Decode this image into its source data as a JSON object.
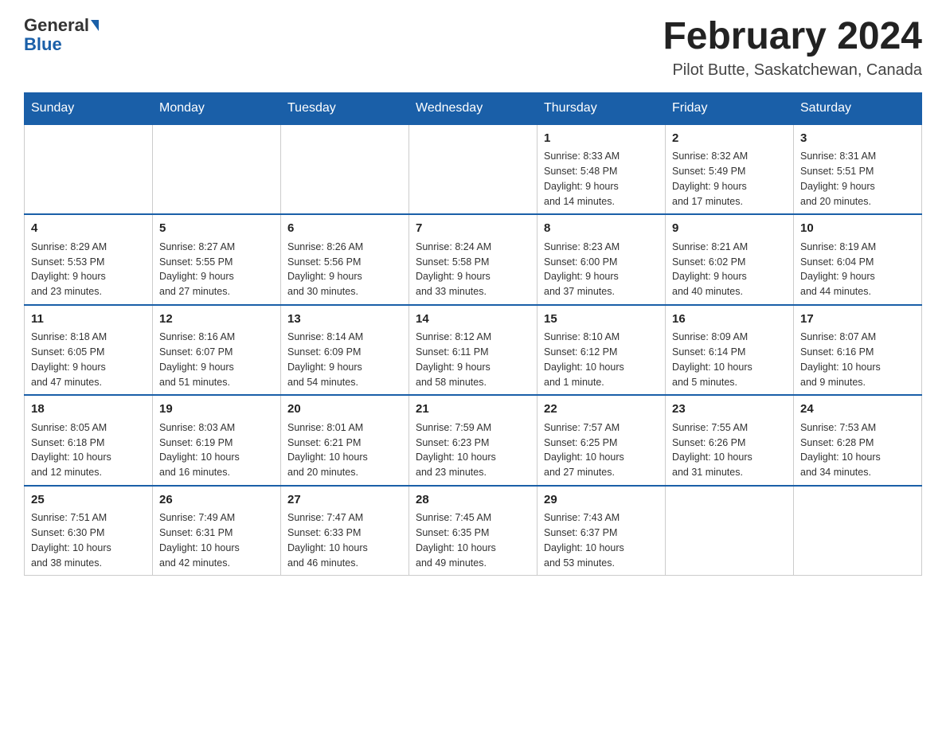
{
  "header": {
    "logo_general": "General",
    "logo_blue": "Blue",
    "month_title": "February 2024",
    "location": "Pilot Butte, Saskatchewan, Canada"
  },
  "weekdays": [
    "Sunday",
    "Monday",
    "Tuesday",
    "Wednesday",
    "Thursday",
    "Friday",
    "Saturday"
  ],
  "weeks": [
    [
      {
        "day": "",
        "info": ""
      },
      {
        "day": "",
        "info": ""
      },
      {
        "day": "",
        "info": ""
      },
      {
        "day": "",
        "info": ""
      },
      {
        "day": "1",
        "info": "Sunrise: 8:33 AM\nSunset: 5:48 PM\nDaylight: 9 hours\nand 14 minutes."
      },
      {
        "day": "2",
        "info": "Sunrise: 8:32 AM\nSunset: 5:49 PM\nDaylight: 9 hours\nand 17 minutes."
      },
      {
        "day": "3",
        "info": "Sunrise: 8:31 AM\nSunset: 5:51 PM\nDaylight: 9 hours\nand 20 minutes."
      }
    ],
    [
      {
        "day": "4",
        "info": "Sunrise: 8:29 AM\nSunset: 5:53 PM\nDaylight: 9 hours\nand 23 minutes."
      },
      {
        "day": "5",
        "info": "Sunrise: 8:27 AM\nSunset: 5:55 PM\nDaylight: 9 hours\nand 27 minutes."
      },
      {
        "day": "6",
        "info": "Sunrise: 8:26 AM\nSunset: 5:56 PM\nDaylight: 9 hours\nand 30 minutes."
      },
      {
        "day": "7",
        "info": "Sunrise: 8:24 AM\nSunset: 5:58 PM\nDaylight: 9 hours\nand 33 minutes."
      },
      {
        "day": "8",
        "info": "Sunrise: 8:23 AM\nSunset: 6:00 PM\nDaylight: 9 hours\nand 37 minutes."
      },
      {
        "day": "9",
        "info": "Sunrise: 8:21 AM\nSunset: 6:02 PM\nDaylight: 9 hours\nand 40 minutes."
      },
      {
        "day": "10",
        "info": "Sunrise: 8:19 AM\nSunset: 6:04 PM\nDaylight: 9 hours\nand 44 minutes."
      }
    ],
    [
      {
        "day": "11",
        "info": "Sunrise: 8:18 AM\nSunset: 6:05 PM\nDaylight: 9 hours\nand 47 minutes."
      },
      {
        "day": "12",
        "info": "Sunrise: 8:16 AM\nSunset: 6:07 PM\nDaylight: 9 hours\nand 51 minutes."
      },
      {
        "day": "13",
        "info": "Sunrise: 8:14 AM\nSunset: 6:09 PM\nDaylight: 9 hours\nand 54 minutes."
      },
      {
        "day": "14",
        "info": "Sunrise: 8:12 AM\nSunset: 6:11 PM\nDaylight: 9 hours\nand 58 minutes."
      },
      {
        "day": "15",
        "info": "Sunrise: 8:10 AM\nSunset: 6:12 PM\nDaylight: 10 hours\nand 1 minute."
      },
      {
        "day": "16",
        "info": "Sunrise: 8:09 AM\nSunset: 6:14 PM\nDaylight: 10 hours\nand 5 minutes."
      },
      {
        "day": "17",
        "info": "Sunrise: 8:07 AM\nSunset: 6:16 PM\nDaylight: 10 hours\nand 9 minutes."
      }
    ],
    [
      {
        "day": "18",
        "info": "Sunrise: 8:05 AM\nSunset: 6:18 PM\nDaylight: 10 hours\nand 12 minutes."
      },
      {
        "day": "19",
        "info": "Sunrise: 8:03 AM\nSunset: 6:19 PM\nDaylight: 10 hours\nand 16 minutes."
      },
      {
        "day": "20",
        "info": "Sunrise: 8:01 AM\nSunset: 6:21 PM\nDaylight: 10 hours\nand 20 minutes."
      },
      {
        "day": "21",
        "info": "Sunrise: 7:59 AM\nSunset: 6:23 PM\nDaylight: 10 hours\nand 23 minutes."
      },
      {
        "day": "22",
        "info": "Sunrise: 7:57 AM\nSunset: 6:25 PM\nDaylight: 10 hours\nand 27 minutes."
      },
      {
        "day": "23",
        "info": "Sunrise: 7:55 AM\nSunset: 6:26 PM\nDaylight: 10 hours\nand 31 minutes."
      },
      {
        "day": "24",
        "info": "Sunrise: 7:53 AM\nSunset: 6:28 PM\nDaylight: 10 hours\nand 34 minutes."
      }
    ],
    [
      {
        "day": "25",
        "info": "Sunrise: 7:51 AM\nSunset: 6:30 PM\nDaylight: 10 hours\nand 38 minutes."
      },
      {
        "day": "26",
        "info": "Sunrise: 7:49 AM\nSunset: 6:31 PM\nDaylight: 10 hours\nand 42 minutes."
      },
      {
        "day": "27",
        "info": "Sunrise: 7:47 AM\nSunset: 6:33 PM\nDaylight: 10 hours\nand 46 minutes."
      },
      {
        "day": "28",
        "info": "Sunrise: 7:45 AM\nSunset: 6:35 PM\nDaylight: 10 hours\nand 49 minutes."
      },
      {
        "day": "29",
        "info": "Sunrise: 7:43 AM\nSunset: 6:37 PM\nDaylight: 10 hours\nand 53 minutes."
      },
      {
        "day": "",
        "info": ""
      },
      {
        "day": "",
        "info": ""
      }
    ]
  ]
}
